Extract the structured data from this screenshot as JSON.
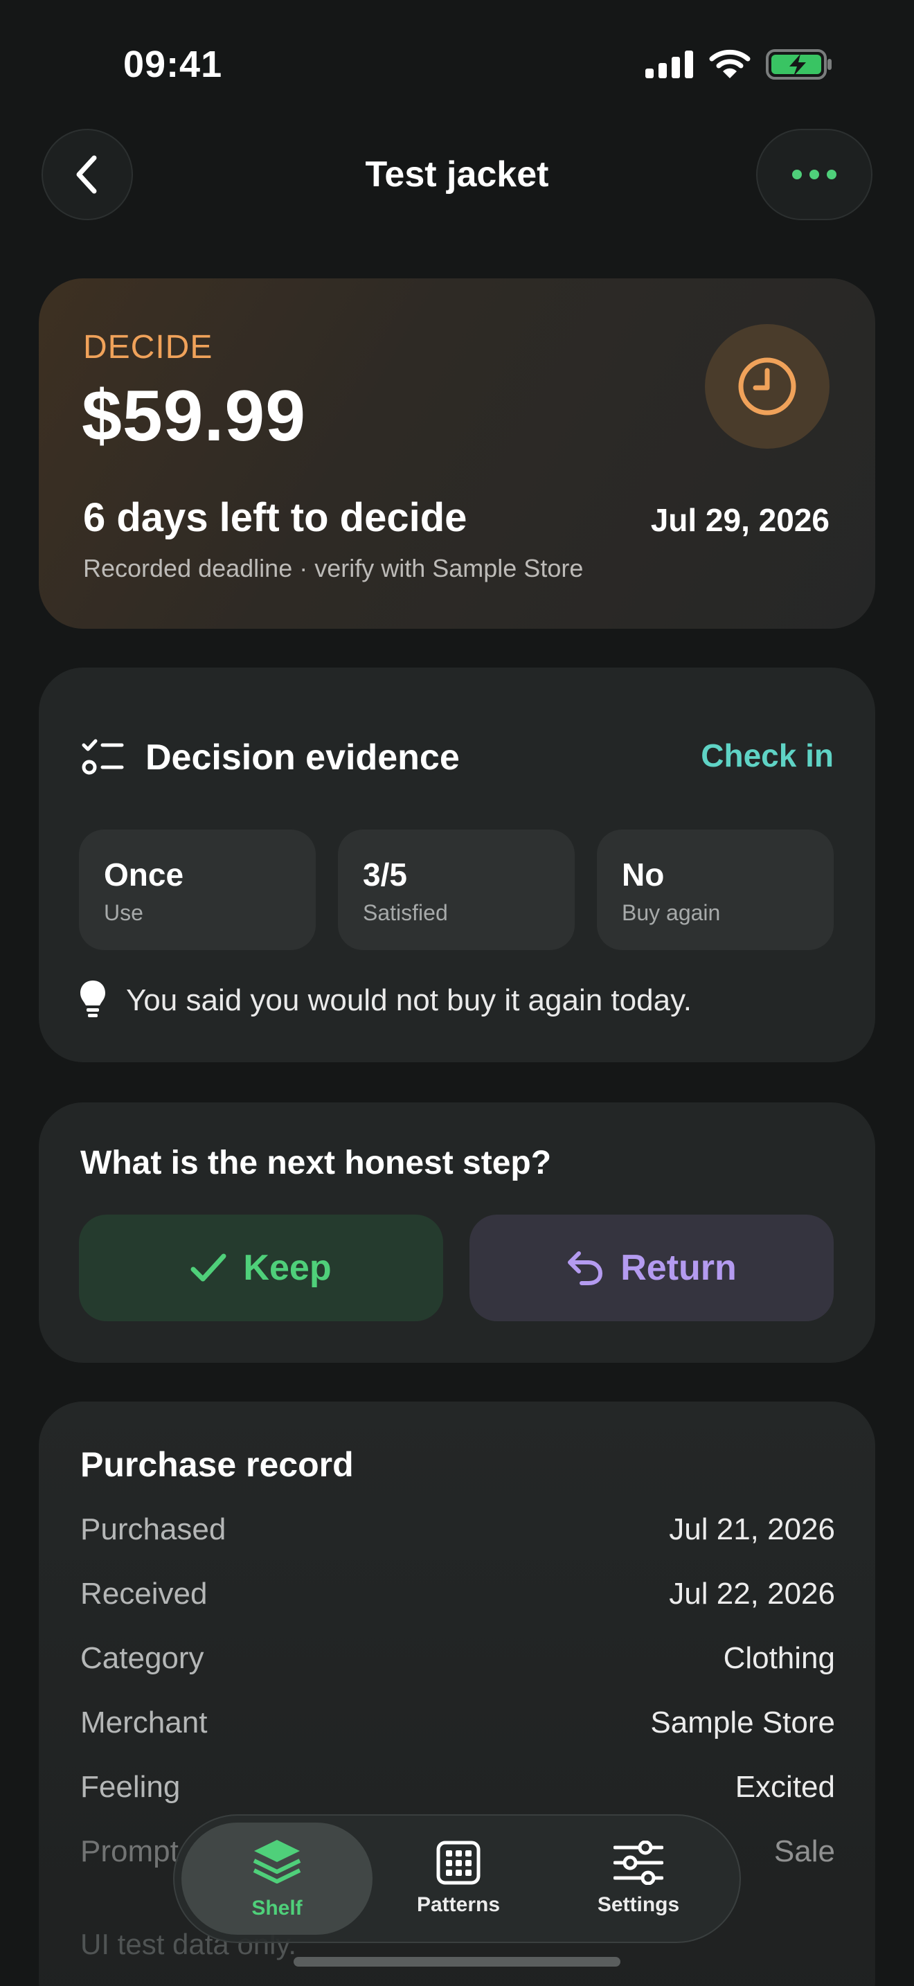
{
  "status_bar": {
    "time": "09:41"
  },
  "nav": {
    "title": "Test jacket"
  },
  "decision": {
    "label": "DECIDE",
    "price": "$59.99",
    "days_left": "6 days left to decide",
    "deadline_date": "Jul 29, 2026",
    "deadline_note": "Recorded deadline · verify with Sample Store"
  },
  "evidence": {
    "title": "Decision evidence",
    "check_in": "Check in",
    "stats": [
      {
        "value": "Once",
        "label": "Use"
      },
      {
        "value": "3/5",
        "label": "Satisfied"
      },
      {
        "value": "No",
        "label": "Buy again"
      }
    ],
    "note": "You said you would not buy it again today."
  },
  "next_step": {
    "title": "What is the next honest step?",
    "keep": "Keep",
    "return": "Return"
  },
  "record": {
    "title": "Purchase record",
    "rows": [
      {
        "key": "Purchased",
        "value": "Jul 21, 2026"
      },
      {
        "key": "Received",
        "value": "Jul 22, 2026"
      },
      {
        "key": "Category",
        "value": "Clothing"
      },
      {
        "key": "Merchant",
        "value": "Sample Store"
      },
      {
        "key": "Feeling",
        "value": "Excited"
      },
      {
        "key": "Prompt",
        "value": "Sale"
      }
    ],
    "footnote": "UI test data only."
  },
  "tabs": [
    {
      "label": "Shelf",
      "icon": "layers-icon",
      "active": true
    },
    {
      "label": "Patterns",
      "icon": "grid-icon",
      "active": false
    },
    {
      "label": "Settings",
      "icon": "sliders-icon",
      "active": false
    }
  ],
  "colors": {
    "accent_orange": "#f0a25a",
    "accent_teal": "#5fd3c5",
    "keep_green": "#4fd07a",
    "return_purple": "#b49bf0"
  }
}
